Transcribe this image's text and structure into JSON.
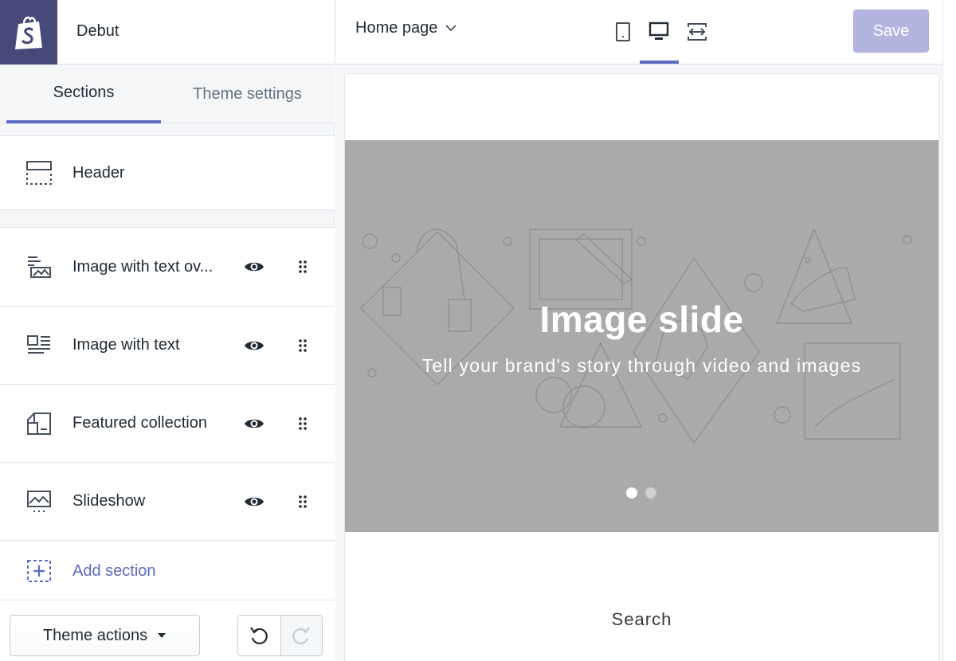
{
  "app": {
    "theme_name": "Debut",
    "save_label": "Save"
  },
  "toolbar": {
    "page_selector": "Home page",
    "devices": [
      "mobile-icon",
      "desktop-icon",
      "fullscreen-icon"
    ],
    "active_device": "desktop"
  },
  "sidebar": {
    "tabs": [
      {
        "label": "Sections",
        "active": true
      },
      {
        "label": "Theme settings",
        "active": false
      }
    ],
    "header_section": {
      "label": "Header",
      "icon": "header-icon"
    },
    "sections": [
      {
        "label": "Image with text ov...",
        "icon": "image-with-text-overlay-icon",
        "visible": true
      },
      {
        "label": "Image with text",
        "icon": "image-with-text-icon",
        "visible": true
      },
      {
        "label": "Featured collection",
        "icon": "featured-collection-icon",
        "visible": true
      },
      {
        "label": "Slideshow",
        "icon": "slideshow-icon",
        "visible": true
      }
    ],
    "add_section_label": "Add section",
    "theme_actions_label": "Theme actions"
  },
  "preview": {
    "slide_title": "Image slide",
    "slide_subtitle": "Tell your brand's story through video and images",
    "slide_count": 2,
    "active_slide": 1,
    "search_label": "Search"
  },
  "colors": {
    "brand_dark": "#47497a",
    "accent": "#5c6ac4",
    "save_disabled": "#b3b5e0",
    "hero_gray": "#a9aaab"
  }
}
